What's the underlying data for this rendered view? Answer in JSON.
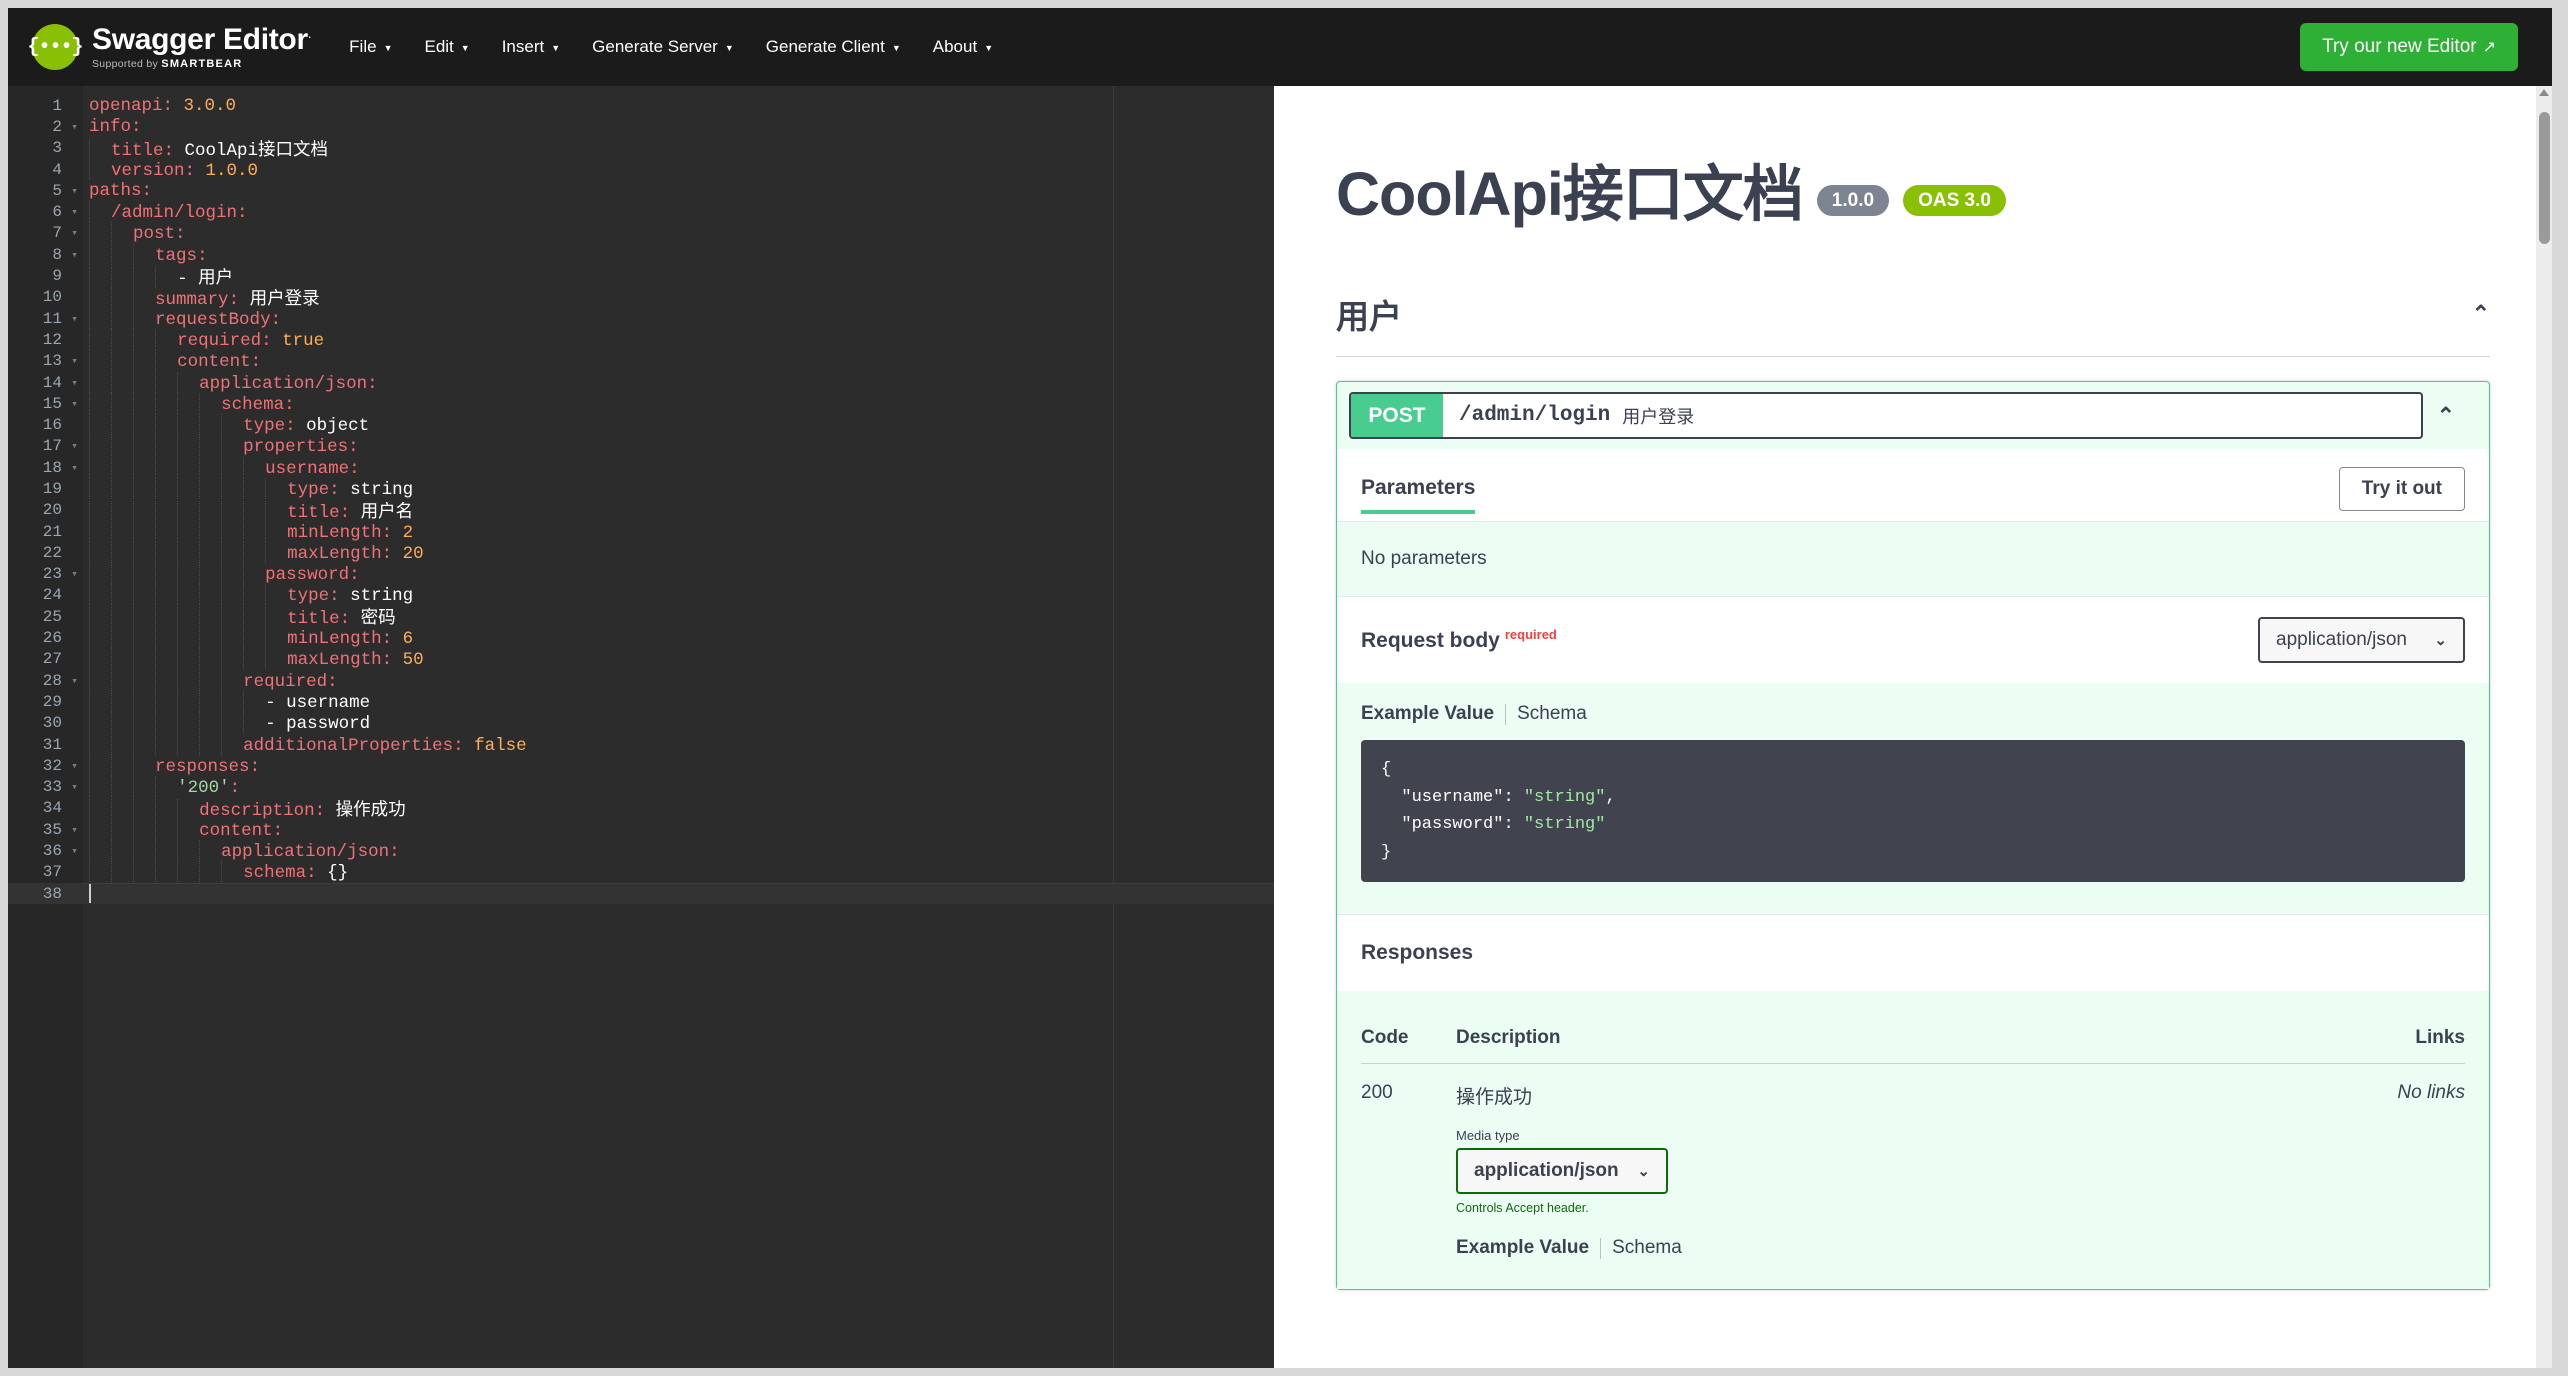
{
  "topbar": {
    "logo_glyph": "{•••}",
    "brand": "Swagger Editor",
    "brand_tm": ".",
    "supported_by_prefix": "Supported by",
    "supported_by_name": "SMARTBEAR",
    "menus": [
      {
        "label": "File",
        "caret": "▼"
      },
      {
        "label": "Edit",
        "caret": "▼"
      },
      {
        "label": "Insert",
        "caret": "▼"
      },
      {
        "label": "Generate Server",
        "caret": "▼"
      },
      {
        "label": "Generate Client",
        "caret": "▼"
      },
      {
        "label": "About",
        "caret": "▼"
      }
    ],
    "new_editor_button": "Try our new Editor",
    "new_editor_icon": "↗"
  },
  "editor": {
    "active_line": 38,
    "total_lines": 38,
    "lines": [
      {
        "n": 1,
        "fold": false,
        "indent": 0,
        "key": "openapi",
        "sep": ": ",
        "val": "3.0.0",
        "vtype": "v"
      },
      {
        "n": 2,
        "fold": true,
        "indent": 0,
        "key": "info",
        "sep": ":",
        "val": "",
        "vtype": ""
      },
      {
        "n": 3,
        "fold": false,
        "indent": 1,
        "key": "title",
        "sep": ": ",
        "val": "CoolApi接口文档",
        "vtype": "s"
      },
      {
        "n": 4,
        "fold": false,
        "indent": 1,
        "key": "version",
        "sep": ": ",
        "val": "1.0.0",
        "vtype": "v"
      },
      {
        "n": 5,
        "fold": true,
        "indent": 0,
        "key": "paths",
        "sep": ":",
        "val": "",
        "vtype": ""
      },
      {
        "n": 6,
        "fold": true,
        "indent": 1,
        "key": "/admin/login",
        "sep": ":",
        "val": "",
        "vtype": ""
      },
      {
        "n": 7,
        "fold": true,
        "indent": 2,
        "key": "post",
        "sep": ":",
        "val": "",
        "vtype": ""
      },
      {
        "n": 8,
        "fold": true,
        "indent": 3,
        "key": "tags",
        "sep": ":",
        "val": "",
        "vtype": ""
      },
      {
        "n": 9,
        "fold": false,
        "indent": 4,
        "key": "- 用户",
        "sep": "",
        "val": "",
        "vtype": "listitem"
      },
      {
        "n": 10,
        "fold": false,
        "indent": 3,
        "key": "summary",
        "sep": ": ",
        "val": "用户登录",
        "vtype": "s"
      },
      {
        "n": 11,
        "fold": true,
        "indent": 3,
        "key": "requestBody",
        "sep": ":",
        "val": "",
        "vtype": ""
      },
      {
        "n": 12,
        "fold": false,
        "indent": 4,
        "key": "required",
        "sep": ": ",
        "val": "true",
        "vtype": "v"
      },
      {
        "n": 13,
        "fold": true,
        "indent": 4,
        "key": "content",
        "sep": ":",
        "val": "",
        "vtype": ""
      },
      {
        "n": 14,
        "fold": true,
        "indent": 5,
        "key": "application/json",
        "sep": ":",
        "val": "",
        "vtype": ""
      },
      {
        "n": 15,
        "fold": true,
        "indent": 6,
        "key": "schema",
        "sep": ":",
        "val": "",
        "vtype": ""
      },
      {
        "n": 16,
        "fold": false,
        "indent": 7,
        "key": "type",
        "sep": ": ",
        "val": "object",
        "vtype": "s"
      },
      {
        "n": 17,
        "fold": true,
        "indent": 7,
        "key": "properties",
        "sep": ":",
        "val": "",
        "vtype": ""
      },
      {
        "n": 18,
        "fold": true,
        "indent": 8,
        "key": "username",
        "sep": ":",
        "val": "",
        "vtype": ""
      },
      {
        "n": 19,
        "fold": false,
        "indent": 9,
        "key": "type",
        "sep": ": ",
        "val": "string",
        "vtype": "s"
      },
      {
        "n": 20,
        "fold": false,
        "indent": 9,
        "key": "title",
        "sep": ": ",
        "val": "用户名",
        "vtype": "s"
      },
      {
        "n": 21,
        "fold": false,
        "indent": 9,
        "key": "minLength",
        "sep": ": ",
        "val": "2",
        "vtype": "v"
      },
      {
        "n": 22,
        "fold": false,
        "indent": 9,
        "key": "maxLength",
        "sep": ": ",
        "val": "20",
        "vtype": "v"
      },
      {
        "n": 23,
        "fold": true,
        "indent": 8,
        "key": "password",
        "sep": ":",
        "val": "",
        "vtype": ""
      },
      {
        "n": 24,
        "fold": false,
        "indent": 9,
        "key": "type",
        "sep": ": ",
        "val": "string",
        "vtype": "s"
      },
      {
        "n": 25,
        "fold": false,
        "indent": 9,
        "key": "title",
        "sep": ": ",
        "val": "密码",
        "vtype": "s"
      },
      {
        "n": 26,
        "fold": false,
        "indent": 9,
        "key": "minLength",
        "sep": ": ",
        "val": "6",
        "vtype": "v"
      },
      {
        "n": 27,
        "fold": false,
        "indent": 9,
        "key": "maxLength",
        "sep": ": ",
        "val": "50",
        "vtype": "v"
      },
      {
        "n": 28,
        "fold": true,
        "indent": 7,
        "key": "required",
        "sep": ":",
        "val": "",
        "vtype": ""
      },
      {
        "n": 29,
        "fold": false,
        "indent": 8,
        "key": "- username",
        "sep": "",
        "val": "",
        "vtype": "listitem"
      },
      {
        "n": 30,
        "fold": false,
        "indent": 8,
        "key": "- password",
        "sep": "",
        "val": "",
        "vtype": "listitem"
      },
      {
        "n": 31,
        "fold": false,
        "indent": 7,
        "key": "additionalProperties",
        "sep": ": ",
        "val": "false",
        "vtype": "v"
      },
      {
        "n": 32,
        "fold": true,
        "indent": 3,
        "key": "responses",
        "sep": ":",
        "val": "",
        "vtype": ""
      },
      {
        "n": 33,
        "fold": true,
        "indent": 4,
        "key": "'200'",
        "sep": ":",
        "val": "",
        "vtype": "quoted"
      },
      {
        "n": 34,
        "fold": false,
        "indent": 5,
        "key": "description",
        "sep": ": ",
        "val": "操作成功",
        "vtype": "s"
      },
      {
        "n": 35,
        "fold": true,
        "indent": 5,
        "key": "content",
        "sep": ":",
        "val": "",
        "vtype": ""
      },
      {
        "n": 36,
        "fold": true,
        "indent": 6,
        "key": "application/json",
        "sep": ":",
        "val": "",
        "vtype": ""
      },
      {
        "n": 37,
        "fold": false,
        "indent": 7,
        "key": "schema",
        "sep": ": ",
        "val": "{}",
        "vtype": "s"
      },
      {
        "n": 38,
        "fold": false,
        "indent": 0,
        "key": "",
        "sep": "",
        "val": "",
        "vtype": ""
      }
    ]
  },
  "swagger": {
    "api_title": "CoolApi接口文档",
    "version_badge": "1.0.0",
    "oas_badge": "OAS 3.0",
    "tag": {
      "name": "用户",
      "collapse_icon": "⌃"
    },
    "operation": {
      "method": "POST",
      "path": "/admin/login",
      "summary": "用户登录",
      "collapse_icon": "⌃",
      "tabs": {
        "parameters": "Parameters"
      },
      "try_it_out": "Try it out",
      "no_parameters": "No parameters",
      "request_body_label": "Request body",
      "request_body_required": "required",
      "request_media_type": "application/json",
      "select_chevron": "⌄",
      "example_tab_active": "Example Value",
      "example_tab_schema": "Schema",
      "example_json": {
        "open": "{",
        "line1_key": "\"username\"",
        "line1_val": "\"string\"",
        "line1_comma": ",",
        "line2_key": "\"password\"",
        "line2_val": "\"string\"",
        "close": "}"
      }
    },
    "responses": {
      "title": "Responses",
      "headers": {
        "code": "Code",
        "description": "Description",
        "links": "Links"
      },
      "rows": [
        {
          "code": "200",
          "description": "操作成功",
          "links": "No links",
          "media_type_label": "Media type",
          "media_type_value": "application/json",
          "accept_note": "Controls Accept header.",
          "example_tab_active": "Example Value",
          "example_tab_schema": "Schema"
        }
      ]
    }
  },
  "colors": {
    "header_bg": "#1b1b1b",
    "swagger_green": "#89bf04",
    "post_green": "#49cc90",
    "button_green": "#2eaf36",
    "text_dark": "#3b4151",
    "required_red": "#f93e3e",
    "editor_bg": "#2c2c2c",
    "yaml_key": "#f07178",
    "yaml_number": "#ffae57",
    "json_string": "#a2e8a2"
  }
}
